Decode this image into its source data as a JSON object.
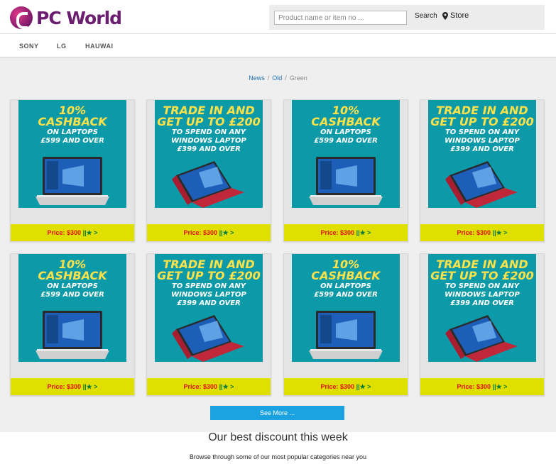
{
  "header": {
    "logo_text": "PC World",
    "search_placeholder": "Product name or item no ...",
    "search_label": "Search",
    "store_label": "Store"
  },
  "brands": [
    "SONY",
    "LG",
    "HAUWAI"
  ],
  "breadcrumb": {
    "items": [
      "News",
      "Old",
      "Green"
    ]
  },
  "promos": {
    "cashback": {
      "line1": "10%",
      "line2": "CASHBACK",
      "line3": "ON LAPTOPS",
      "line4": "£599 AND OVER"
    },
    "tradein": {
      "line1": "TRADE IN AND",
      "line2": "GET UP TO £200",
      "line3": "TO SPEND ON ANY",
      "line4": "WINDOWS LAPTOP",
      "line5": "£399 AND OVER"
    }
  },
  "products": [
    {
      "promo": "cashback",
      "price": "Price: $300",
      "suffix": " ||★ >"
    },
    {
      "promo": "tradein",
      "price": "Price: $300",
      "suffix": " ||★ >"
    },
    {
      "promo": "cashback",
      "price": "Price: $300",
      "suffix": " ||★ >"
    },
    {
      "promo": "tradein",
      "price": "Price: $300",
      "suffix": " ||★ >"
    },
    {
      "promo": "cashback",
      "price": "Price: $300",
      "suffix": " ||★ >"
    },
    {
      "promo": "tradein",
      "price": "Price: $300",
      "suffix": " ||★ >"
    },
    {
      "promo": "cashback",
      "price": "Price: $300",
      "suffix": " ||★ >"
    },
    {
      "promo": "tradein",
      "price": "Price: $300",
      "suffix": " ||★ >"
    }
  ],
  "see_more_label": "See More ...",
  "best": {
    "title": "Our best discount this week",
    "subtitle": "Browse through some of our most popular categories near you"
  },
  "colors": {
    "accent": "#1aa3e0",
    "price_bar": "#dfe000",
    "banner": "#0d9aa8",
    "brand": "#6b1e6f"
  }
}
